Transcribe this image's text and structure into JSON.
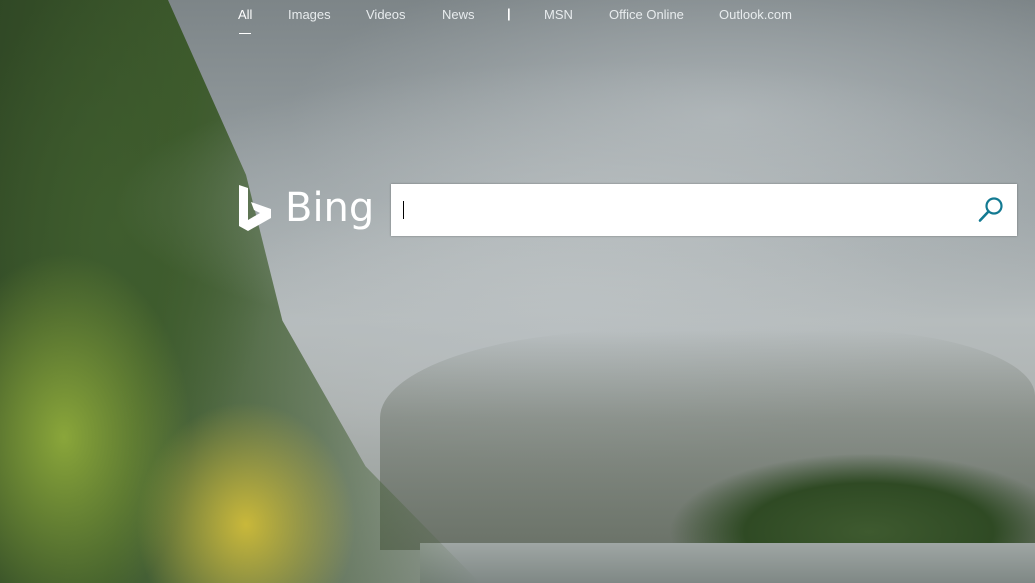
{
  "nav": {
    "items": [
      {
        "label": "All",
        "active": true
      },
      {
        "label": "Images"
      },
      {
        "label": "Videos"
      },
      {
        "label": "News"
      },
      {
        "label": "MSN"
      },
      {
        "label": "Office Online"
      },
      {
        "label": "Outlook.com"
      }
    ],
    "separator": "|"
  },
  "logo": {
    "text": "Bing",
    "icon": "bing-b-icon"
  },
  "search": {
    "value": "",
    "placeholder": "",
    "icon": "search-icon"
  },
  "colors": {
    "nav_text": "#e8ecee",
    "search_icon": "#137a92",
    "search_bg": "#ffffff"
  }
}
